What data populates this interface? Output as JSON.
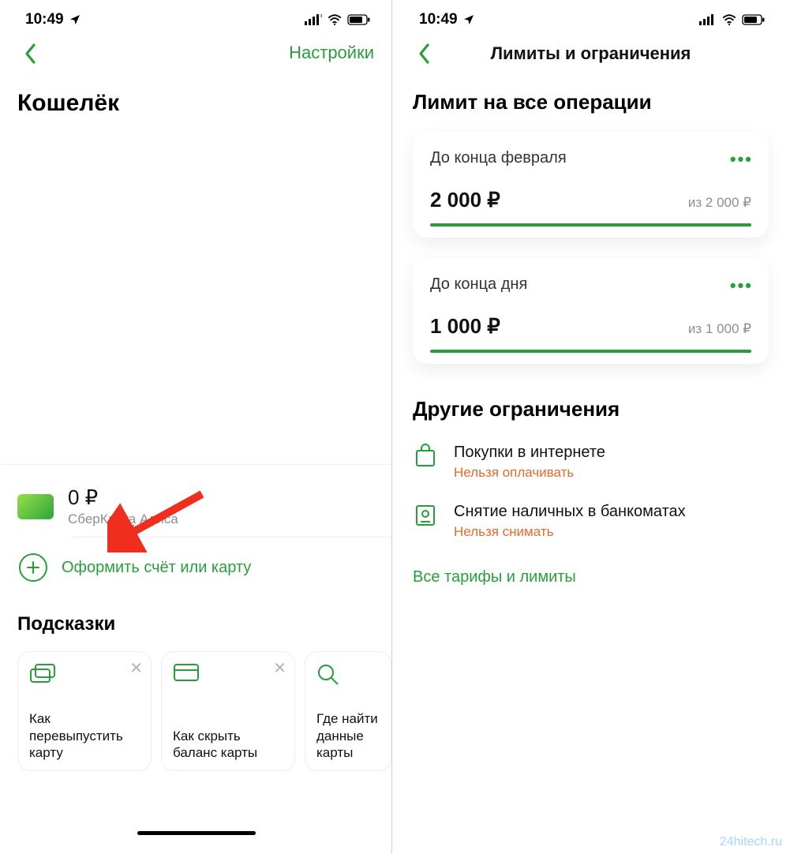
{
  "status": {
    "time": "10:49"
  },
  "left": {
    "nav": {
      "settings": "Настройки"
    },
    "title": "Кошелёк",
    "card": {
      "balance": "0 ₽",
      "name": "СберКарта Алиса"
    },
    "add": "Оформить счёт или карту",
    "tipsTitle": "Подсказки",
    "tips": [
      {
        "text": "Как перевыпустить карту"
      },
      {
        "text": "Как скрыть баланс карты"
      },
      {
        "text": "Где найти данные карты"
      }
    ]
  },
  "right": {
    "navTitle": "Лимиты и ограничения",
    "section1Title": "Лимит на все операции",
    "limits": [
      {
        "label": "До конца февраля",
        "amount": "2 000 ₽",
        "of": "из 2 000 ₽"
      },
      {
        "label": "До конца дня",
        "amount": "1 000 ₽",
        "of": "из 1 000 ₽"
      }
    ],
    "section2Title": "Другие ограничения",
    "restrictions": [
      {
        "title": "Покупки в интернете",
        "sub": "Нельзя оплачивать"
      },
      {
        "title": "Снятие наличных в банкоматах",
        "sub": "Нельзя снимать"
      }
    ],
    "allLink": "Все тарифы и лимиты"
  },
  "watermark": "24hitech.ru"
}
